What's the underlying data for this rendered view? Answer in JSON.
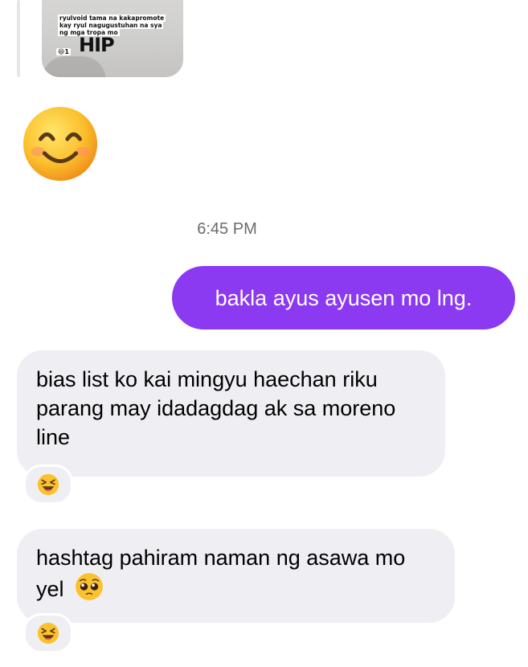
{
  "shared_post": {
    "caption": "ryulvoid tama na kakapromote kay ryul nagugustuhan na sya ng mga tropa mo",
    "reaction_count": "1",
    "big_text": "HIP"
  },
  "timestamp": "6:45 PM",
  "messages": [
    {
      "text": "bakla ayus ayusen mo lng.",
      "direction": "outgoing"
    },
    {
      "text": "bias list ko kai mingyu haechan riku parang may idadagdag ak sa moreno line",
      "direction": "incoming",
      "reaction": "laughing-emoji"
    },
    {
      "text": "hashtag pahiram naman ng asawa mo yel",
      "direction": "incoming",
      "reaction": "laughing-emoji",
      "trailing_emoji": "pleading-face-emoji"
    }
  ],
  "colors": {
    "outgoing_bubble": "#8b3af2",
    "incoming_bubble": "#efeff3",
    "timestamp": "#6b6b70"
  }
}
